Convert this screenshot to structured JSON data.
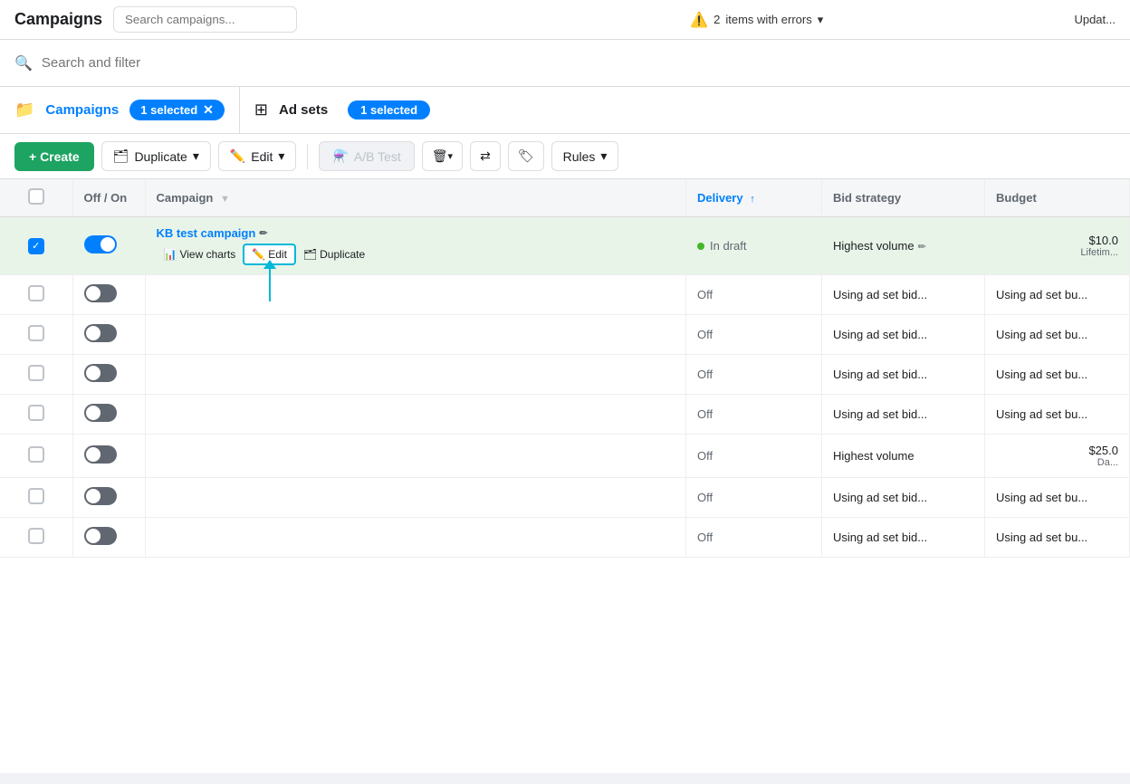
{
  "topbar": {
    "title": "Campaigns",
    "errors_count": "2",
    "errors_label": "items with errors",
    "update_label": "Updat..."
  },
  "search": {
    "placeholder": "Search and filter"
  },
  "tabs": {
    "campaigns": {
      "label": "Campaigns",
      "selected_label": "1 selected"
    },
    "adsets": {
      "label": "Ad sets",
      "selected_label": "1 selected"
    }
  },
  "toolbar": {
    "create_label": "+ Create",
    "duplicate_label": "Duplicate",
    "edit_label": "Edit",
    "ab_test_label": "A/B Test",
    "rules_label": "Rules"
  },
  "table": {
    "headers": [
      "Off / On",
      "Campaign",
      "Delivery",
      "Bid strategy",
      "Budget"
    ],
    "rows": [
      {
        "id": 1,
        "checked": true,
        "toggle": "on",
        "campaign_name": "KB test campaign",
        "delivery": "In draft",
        "delivery_type": "draft",
        "bid_strategy": "Highest volume",
        "budget": "$10.0",
        "budget_note": "Lifetim..."
      },
      {
        "id": 2,
        "checked": false,
        "toggle": "dark",
        "campaign_name": "",
        "delivery": "Off",
        "delivery_type": "off",
        "bid_strategy": "Using ad set bid...",
        "budget": "Using ad set bu..."
      },
      {
        "id": 3,
        "checked": false,
        "toggle": "dark",
        "campaign_name": "",
        "delivery": "Off",
        "delivery_type": "off",
        "bid_strategy": "Using ad set bid...",
        "budget": "Using ad set bu..."
      },
      {
        "id": 4,
        "checked": false,
        "toggle": "dark",
        "campaign_name": "",
        "delivery": "Off",
        "delivery_type": "off",
        "bid_strategy": "Using ad set bid...",
        "budget": "Using ad set bu..."
      },
      {
        "id": 5,
        "checked": false,
        "toggle": "dark",
        "campaign_name": "",
        "delivery": "Off",
        "delivery_type": "off",
        "bid_strategy": "Using ad set bid...",
        "budget": "Using ad set bu..."
      },
      {
        "id": 6,
        "checked": false,
        "toggle": "dark",
        "campaign_name": "",
        "delivery": "Off",
        "delivery_type": "off",
        "bid_strategy": "Highest volume",
        "budget": "$25.0",
        "budget_note": "Da..."
      },
      {
        "id": 7,
        "checked": false,
        "toggle": "dark",
        "campaign_name": "",
        "delivery": "Off",
        "delivery_type": "off",
        "bid_strategy": "Using ad set bid...",
        "budget": "Using ad set bu..."
      },
      {
        "id": 8,
        "checked": false,
        "toggle": "dark",
        "campaign_name": "",
        "delivery": "Off",
        "delivery_type": "off",
        "bid_strategy": "Using ad set bid...",
        "budget": "Using ad set bu..."
      }
    ],
    "inline_actions": {
      "view_charts": "View charts",
      "edit": "Edit",
      "duplicate": "Duplicate"
    }
  }
}
